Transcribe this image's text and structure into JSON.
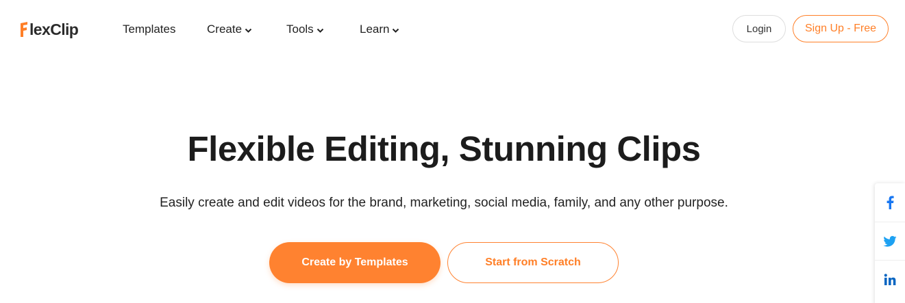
{
  "brand": {
    "logo_text_first": "lex",
    "logo_text_second": "Clip",
    "accent_color": "#ff7f27"
  },
  "nav": {
    "items": [
      {
        "label": "Templates",
        "has_dropdown": false
      },
      {
        "label": "Create",
        "has_dropdown": true
      },
      {
        "label": "Tools",
        "has_dropdown": true
      },
      {
        "label": "Learn",
        "has_dropdown": true
      }
    ],
    "login_label": "Login",
    "signup_label": "Sign Up - Free"
  },
  "hero": {
    "title": "Flexible Editing, Stunning Clips",
    "subtitle": "Easily create and edit videos for the brand, marketing, social media, family, and any other purpose.",
    "primary_button": "Create by Templates",
    "secondary_button": "Start from Scratch"
  },
  "social": {
    "icons": [
      "facebook-icon",
      "twitter-icon",
      "linkedin-icon"
    ],
    "facebook_color": "#1877f2",
    "twitter_color": "#1da1f2",
    "linkedin_color": "#0a66c2"
  }
}
